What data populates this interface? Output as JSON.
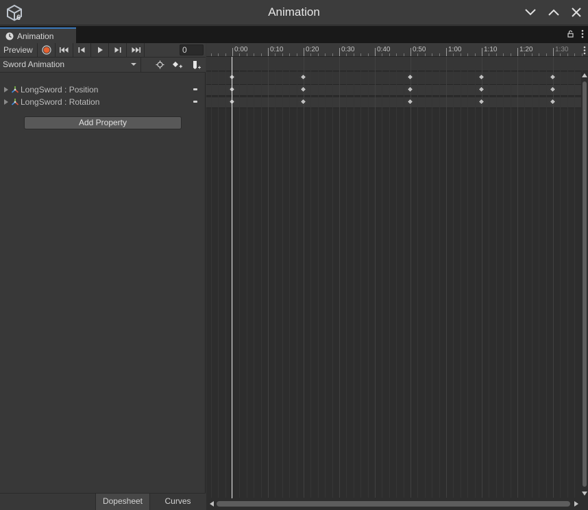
{
  "window": {
    "title": "Animation",
    "controls": [
      "chevron-down-icon",
      "chevron-up-icon",
      "close-icon"
    ]
  },
  "tab": {
    "label": "Animation",
    "icon": "clock-icon"
  },
  "toolbar": {
    "preview_label": "Preview",
    "record_color": "#e4602f",
    "frame_value": "0",
    "buttons": [
      "record-icon",
      "first-key-icon",
      "prev-key-icon",
      "play-icon",
      "next-key-icon",
      "last-key-icon"
    ]
  },
  "clip": {
    "selected": "Sword Animation",
    "buttons": [
      "filter-selection-icon",
      "add-keyframe-icon",
      "add-event-icon"
    ]
  },
  "properties": [
    {
      "label": "LongSword : Position",
      "icon": "transform-axes-icon"
    },
    {
      "label": "LongSword : Rotation",
      "icon": "transform-axes-icon"
    }
  ],
  "add_property_label": "Add Property",
  "bottom_tabs": {
    "dopesheet": "Dopesheet",
    "curves": "Curves"
  },
  "timeline": {
    "ruler_labels": [
      "0:00",
      "0:10",
      "0:20",
      "0:30",
      "0:40",
      "0:50",
      "1:00",
      "1:10",
      "1:20",
      "1:30"
    ],
    "keyframe_times": [
      "0:00",
      "0:20",
      "0:50",
      "1:10",
      "1:30"
    ],
    "playhead_time": "0:00"
  },
  "colors": {
    "accent": "#3a79bb",
    "record": "#e4602f"
  }
}
